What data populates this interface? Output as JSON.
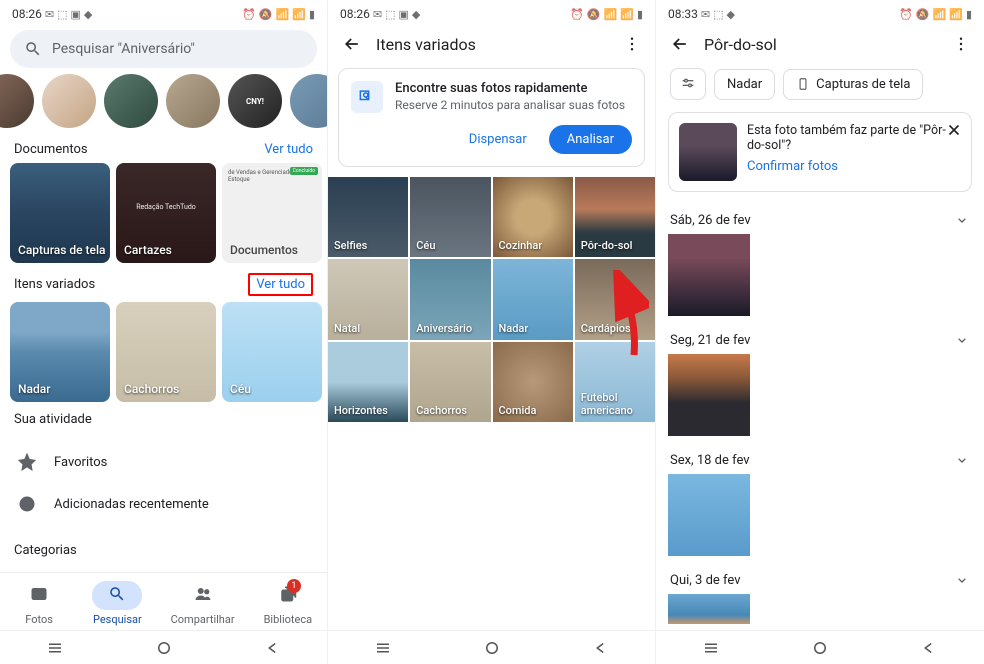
{
  "screen1": {
    "time": "08:26",
    "search_placeholder": "Pesquisar \"Aniversário\"",
    "avatar_label": "CNY!",
    "section_docs": "Documentos",
    "section_items": "Itens variados",
    "see_all": "Ver tudo",
    "doc_tiles": {
      "tela": "Capturas de tela",
      "cartazes": "Cartazes",
      "cartaz_text": "Redação TechTudo",
      "documentos": "Documentos",
      "doc_badge": "Concluído",
      "doc_title": "de Vendas e Gerenciador de Estoque"
    },
    "item_tiles": {
      "nadar": "Nadar",
      "cachorros": "Cachorros",
      "ceu": "Céu"
    },
    "section_activity": "Sua atividade",
    "favorites": "Favoritos",
    "recent": "Adicionadas recentemente",
    "section_categories": "Categorias",
    "nav": {
      "fotos": "Fotos",
      "pesquisar": "Pesquisar",
      "compartilhar": "Compartilhar",
      "biblioteca": "Biblioteca",
      "badge": "1"
    }
  },
  "screen2": {
    "time": "08:26",
    "title": "Itens variados",
    "banner_heading": "Encontre suas fotos rapidamente",
    "banner_sub": "Reserve 2 minutos para analisar suas fotos",
    "btn_dispensar": "Dispensar",
    "btn_analisar": "Analisar",
    "grid": [
      "Selfies",
      "Céu",
      "Cozinhar",
      "Pôr-do-sol",
      "Natal",
      "Aniversário",
      "Nadar",
      "Cardápios",
      "Horizontes",
      "Cachorros",
      "Comida",
      "Futebol americano"
    ]
  },
  "screen3": {
    "time": "08:33",
    "title": "Pôr-do-sol",
    "chip_nadar": "Nadar",
    "chip_capturas": "Capturas de tela",
    "confirm_text": "Esta foto também faz parte de \"Pôr-do-sol\"?",
    "confirm_link": "Confirmar fotos",
    "dates": [
      "Sáb, 26 de fev",
      "Seg, 21 de fev",
      "Sex, 18 de fev",
      "Qui, 3 de fev"
    ]
  }
}
